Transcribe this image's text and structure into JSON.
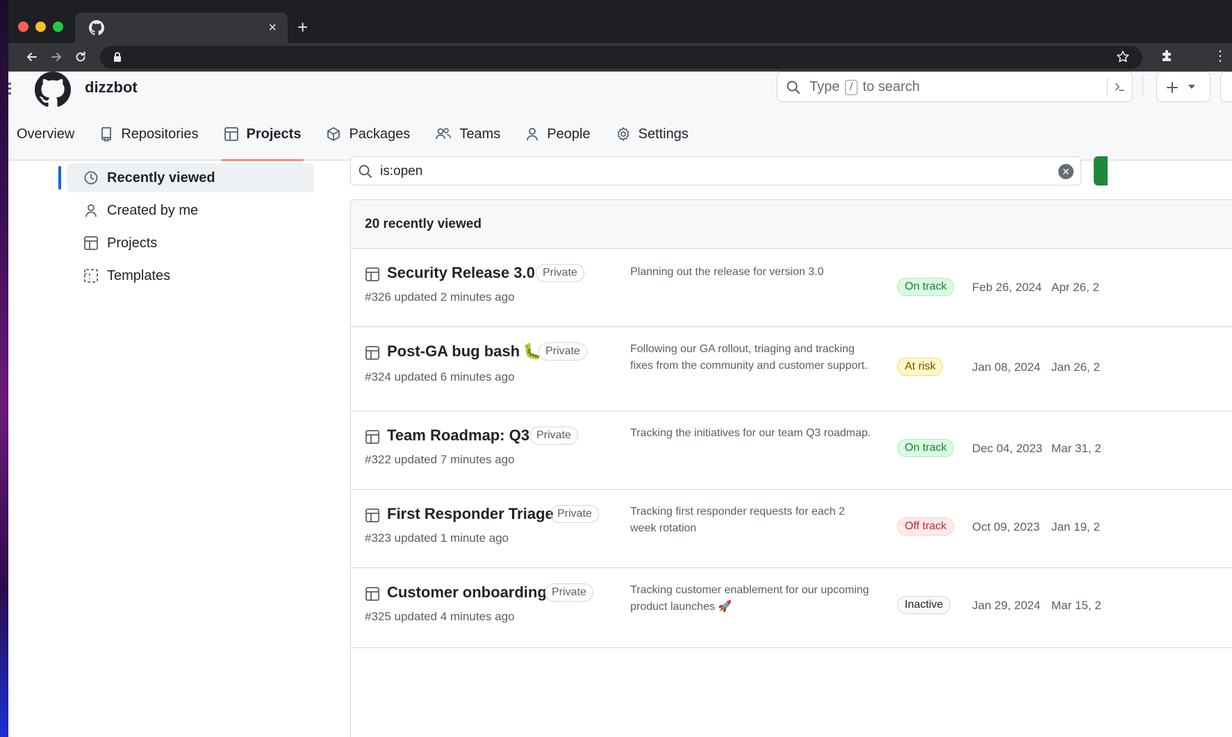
{
  "browser": {
    "close_glyph": "×",
    "new_tab_glyph": "+",
    "menu_glyph": "⋮"
  },
  "header": {
    "org_name": "dizzbot",
    "search_pre": "Type",
    "search_key": "/",
    "search_post": "to search"
  },
  "org_nav": [
    {
      "label": "Overview",
      "icon": "overview-icon"
    },
    {
      "label": "Repositories",
      "icon": "repo-icon"
    },
    {
      "label": "Projects",
      "icon": "table-icon"
    },
    {
      "label": "Packages",
      "icon": "package-icon"
    },
    {
      "label": "Teams",
      "icon": "people-icon"
    },
    {
      "label": "People",
      "icon": "person-icon"
    },
    {
      "label": "Settings",
      "icon": "gear-icon"
    }
  ],
  "sidebar": [
    {
      "label": "Recently viewed",
      "icon": "clock-icon"
    },
    {
      "label": "Created by me",
      "icon": "person-icon"
    },
    {
      "label": "Projects",
      "icon": "table-icon"
    },
    {
      "label": "Templates",
      "icon": "template-icon"
    }
  ],
  "filter": {
    "value": "is:open"
  },
  "list": {
    "heading": "20 recently viewed",
    "items": [
      {
        "title": "Security Release 3.0",
        "emoji": "",
        "visibility": "Private",
        "meta": "#326 updated 2 minutes ago",
        "description": "Planning out the release for version 3.0",
        "status": "On track",
        "status_color": "#1a7f37",
        "start": "Feb 26, 2024",
        "end": "Apr 26, 2"
      },
      {
        "title": "Post-GA bug bash",
        "emoji": "🐛",
        "visibility": "Private",
        "meta": "#324 updated 6 minutes ago",
        "description": "Following our GA rollout, triaging and tracking fixes from the community and customer support.",
        "status": "At risk",
        "status_color": "#7d4e00",
        "start": "Jan 08, 2024",
        "end": "Jan 26, 2"
      },
      {
        "title": "Team Roadmap: Q3",
        "emoji": "",
        "visibility": "Private",
        "meta": "#322 updated 7 minutes ago",
        "description": "Tracking the initiatives for our team Q3 roadmap.",
        "status": "On track",
        "status_color": "#1a7f37",
        "start": "Dec 04, 2023",
        "end": "Mar 31, 2"
      },
      {
        "title": "First Responder Triage",
        "emoji": "",
        "visibility": "Private",
        "meta": "#323 updated 1 minute ago",
        "description": "Tracking first responder requests for each 2 week rotation",
        "status": "Off track",
        "status_color": "#cf222e",
        "start": "Oct 09, 2023",
        "end": "Jan 19, 2"
      },
      {
        "title": "Customer onboarding",
        "emoji": "",
        "visibility": "Private",
        "meta": "#325 updated 4 minutes ago",
        "description": "Tracking customer enablement for our upcoming product launches 🚀",
        "status": "Inactive",
        "status_color": "#1f2328",
        "start": "Jan 29, 2024",
        "end": "Mar 15, 2"
      }
    ]
  }
}
